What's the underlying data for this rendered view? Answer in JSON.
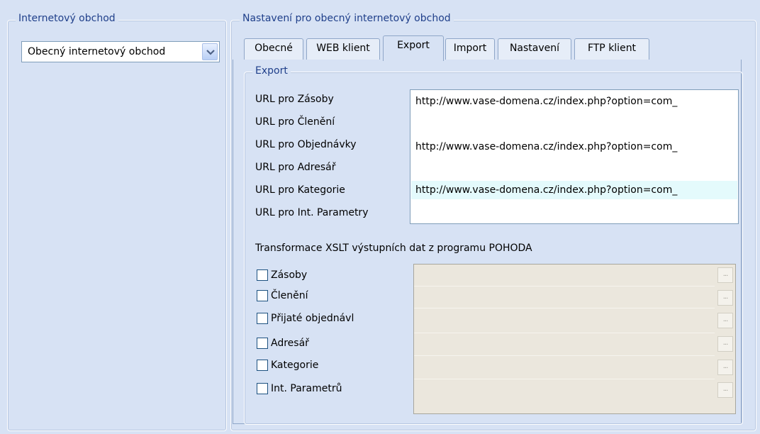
{
  "left_group": {
    "title": "Internetový obchod",
    "combo_value": "Obecný internetový obchod"
  },
  "right_group": {
    "title": "Nastavení pro obecný internetový obchod"
  },
  "tabs": [
    {
      "label": "Obecné"
    },
    {
      "label": "WEB klient"
    },
    {
      "label": "Export"
    },
    {
      "label": "Import"
    },
    {
      "label": "Nastavení"
    },
    {
      "label": "FTP klient"
    }
  ],
  "active_tab": "Export",
  "export_group": {
    "title": "Export",
    "url_fields": [
      {
        "label": "URL pro Zásoby",
        "value": "http://www.vase-domena.cz/index.php?option=com_"
      },
      {
        "label": "URL pro Členění",
        "value": ""
      },
      {
        "label": "URL pro Objednávky",
        "value": "http://www.vase-domena.cz/index.php?option=com_"
      },
      {
        "label": "URL pro Adresář",
        "value": ""
      },
      {
        "label": "URL pro Kategorie",
        "value": "http://www.vase-domena.cz/index.php?option=com_"
      },
      {
        "label": "URL pro Int. Parametry",
        "value": ""
      }
    ],
    "xslt_heading": "Transformace XSLT výstupních dat z programu POHODA",
    "xslt_items": [
      {
        "label": "Zásoby",
        "checked": false
      },
      {
        "label": "Členění",
        "checked": false
      },
      {
        "label": "Přijaté objednávl",
        "checked": false
      },
      {
        "label": "Adresář",
        "checked": false
      },
      {
        "label": "Kategorie",
        "checked": false
      },
      {
        "label": "Int. Parametrů",
        "checked": false
      }
    ],
    "browse_label": "..."
  },
  "colors": {
    "background": "#d7e2f4",
    "title_text": "#1f3f8a",
    "highlight_row": "#e4fafc"
  }
}
